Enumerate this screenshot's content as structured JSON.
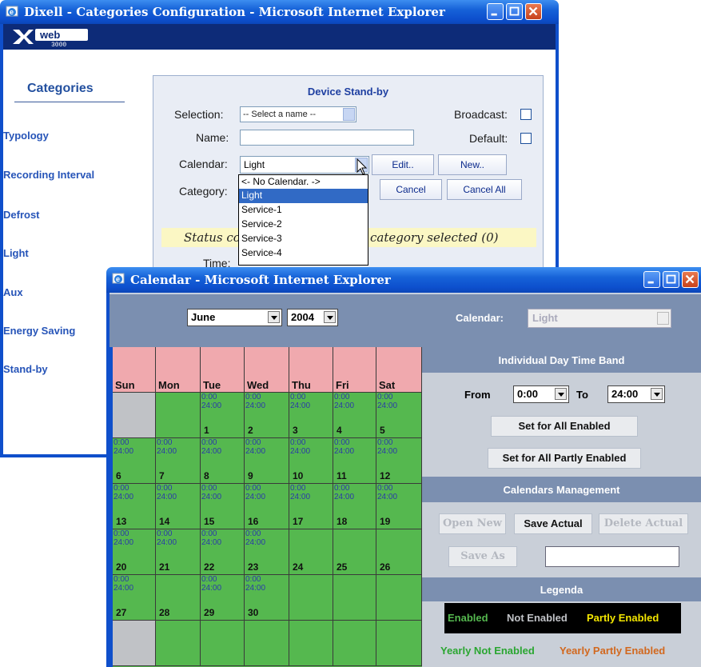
{
  "dixell": {
    "title": "Dixell - Categories Configuration - Microsoft Internet Explorer",
    "sidebar": {
      "heading": "Categories",
      "items": [
        {
          "label": "Typology"
        },
        {
          "label": "Recording Interval"
        },
        {
          "label": "Defrost"
        },
        {
          "label": "Light"
        },
        {
          "label": "Aux"
        },
        {
          "label": "Energy Saving"
        },
        {
          "label": "Stand-by"
        }
      ]
    },
    "form": {
      "section_title": "Device Stand-by",
      "selection_label": "Selection:",
      "selection_value": "-- Select a name --",
      "broadcast_label": "Broadcast:",
      "name_label": "Name:",
      "name_value": "",
      "default_label": "Default:",
      "calendar_label": "Calendar:",
      "calendar_value": "Light",
      "edit_button": "Edit..",
      "new_button": "New..",
      "category_label": "Category:",
      "cancel_button": "Cancel",
      "cancel_all_button": "Cancel All",
      "status_left": "Status co",
      "status_right": "category selected  (0)",
      "time_label": "Time:"
    },
    "calendar_dropdown_options": [
      "<-  No Calendar.  ->",
      "Light",
      "Service-1",
      "Service-2",
      "Service-3",
      "Service-4"
    ],
    "calendar_dropdown_selected": "Light"
  },
  "calendar_window": {
    "title": "Calendar - Microsoft Internet Explorer",
    "month": "June",
    "year": "2004",
    "calendar_label": "Calendar:",
    "calendar_value": "Light",
    "day_headers": [
      "Sun",
      "Mon",
      "Tue",
      "Wed",
      "Thu",
      "Fri",
      "Sat"
    ],
    "time_text": [
      "0:00",
      "24:00"
    ],
    "weeks": [
      [
        {
          "day": "",
          "state": "none"
        },
        {
          "day": "",
          "state": "enabled"
        },
        {
          "day": "1",
          "state": "enabled",
          "band": true
        },
        {
          "day": "2",
          "state": "enabled",
          "band": true
        },
        {
          "day": "3",
          "state": "enabled",
          "band": true
        },
        {
          "day": "4",
          "state": "enabled",
          "band": true
        },
        {
          "day": "5",
          "state": "enabled",
          "band": true
        }
      ],
      [
        {
          "day": "6",
          "state": "enabled",
          "band": true
        },
        {
          "day": "7",
          "state": "enabled",
          "band": true
        },
        {
          "day": "8",
          "state": "enabled",
          "band": true
        },
        {
          "day": "9",
          "state": "enabled",
          "band": true
        },
        {
          "day": "10",
          "state": "enabled",
          "band": true
        },
        {
          "day": "11",
          "state": "enabled",
          "band": true
        },
        {
          "day": "12",
          "state": "enabled",
          "band": true
        }
      ],
      [
        {
          "day": "13",
          "state": "enabled",
          "band": true
        },
        {
          "day": "14",
          "state": "enabled",
          "band": true
        },
        {
          "day": "15",
          "state": "enabled",
          "band": true
        },
        {
          "day": "16",
          "state": "enabled",
          "band": true
        },
        {
          "day": "17",
          "state": "enabled",
          "band": true
        },
        {
          "day": "18",
          "state": "enabled",
          "band": true
        },
        {
          "day": "19",
          "state": "enabled",
          "band": true
        }
      ],
      [
        {
          "day": "20",
          "state": "enabled",
          "band": true
        },
        {
          "day": "21",
          "state": "enabled",
          "band": true
        },
        {
          "day": "22",
          "state": "enabled",
          "band": true
        },
        {
          "day": "23",
          "state": "enabled",
          "band": true
        },
        {
          "day": "24",
          "state": "enabled",
          "band": false
        },
        {
          "day": "25",
          "state": "enabled",
          "band": false
        },
        {
          "day": "26",
          "state": "enabled",
          "band": false
        }
      ],
      [
        {
          "day": "27",
          "state": "enabled",
          "band": true
        },
        {
          "day": "28",
          "state": "enabled",
          "band": false
        },
        {
          "day": "29",
          "state": "enabled",
          "band": true
        },
        {
          "day": "30",
          "state": "enabled",
          "band": true
        },
        {
          "day": "",
          "state": "enabled"
        },
        {
          "day": "",
          "state": "enabled"
        },
        {
          "day": "",
          "state": "enabled"
        }
      ],
      [
        {
          "day": "",
          "state": "none"
        },
        {
          "day": "",
          "state": "enabled"
        },
        {
          "day": "",
          "state": "enabled"
        },
        {
          "day": "",
          "state": "enabled"
        },
        {
          "day": "",
          "state": "enabled"
        },
        {
          "day": "",
          "state": "enabled"
        },
        {
          "day": "",
          "state": "enabled"
        }
      ]
    ],
    "band": {
      "title": "Individual Day Time Band",
      "from_label": "From",
      "from_value": "0:00",
      "to_label": "To",
      "to_value": "24:00",
      "set_all_enabled": "Set for All Enabled",
      "set_all_partly": "Set for All Partly Enabled"
    },
    "management": {
      "title": "Calendars Management",
      "open_new": "Open New",
      "save_actual": "Save Actual",
      "delete_actual": "Delete Actual",
      "save_as": "Save As",
      "save_as_value": ""
    },
    "legend": {
      "title": "Legenda",
      "enabled": "Enabled",
      "not_enabled": "Not Enabled",
      "partly_enabled": "Partly Enabled",
      "yearly_not_enabled": "Yearly Not Enabled",
      "yearly_partly_enabled": "Yearly Partly Enabled"
    },
    "colors": {
      "enabled": "#55b84f",
      "not_enabled": "#c0c2c6",
      "header_pink": "#f0a9ae",
      "panel_blue": "#7b8fb0",
      "legend_yearly_not": "#2aa631",
      "legend_yearly_partly": "#d2681e",
      "legend_partly": "#f3e600"
    }
  }
}
